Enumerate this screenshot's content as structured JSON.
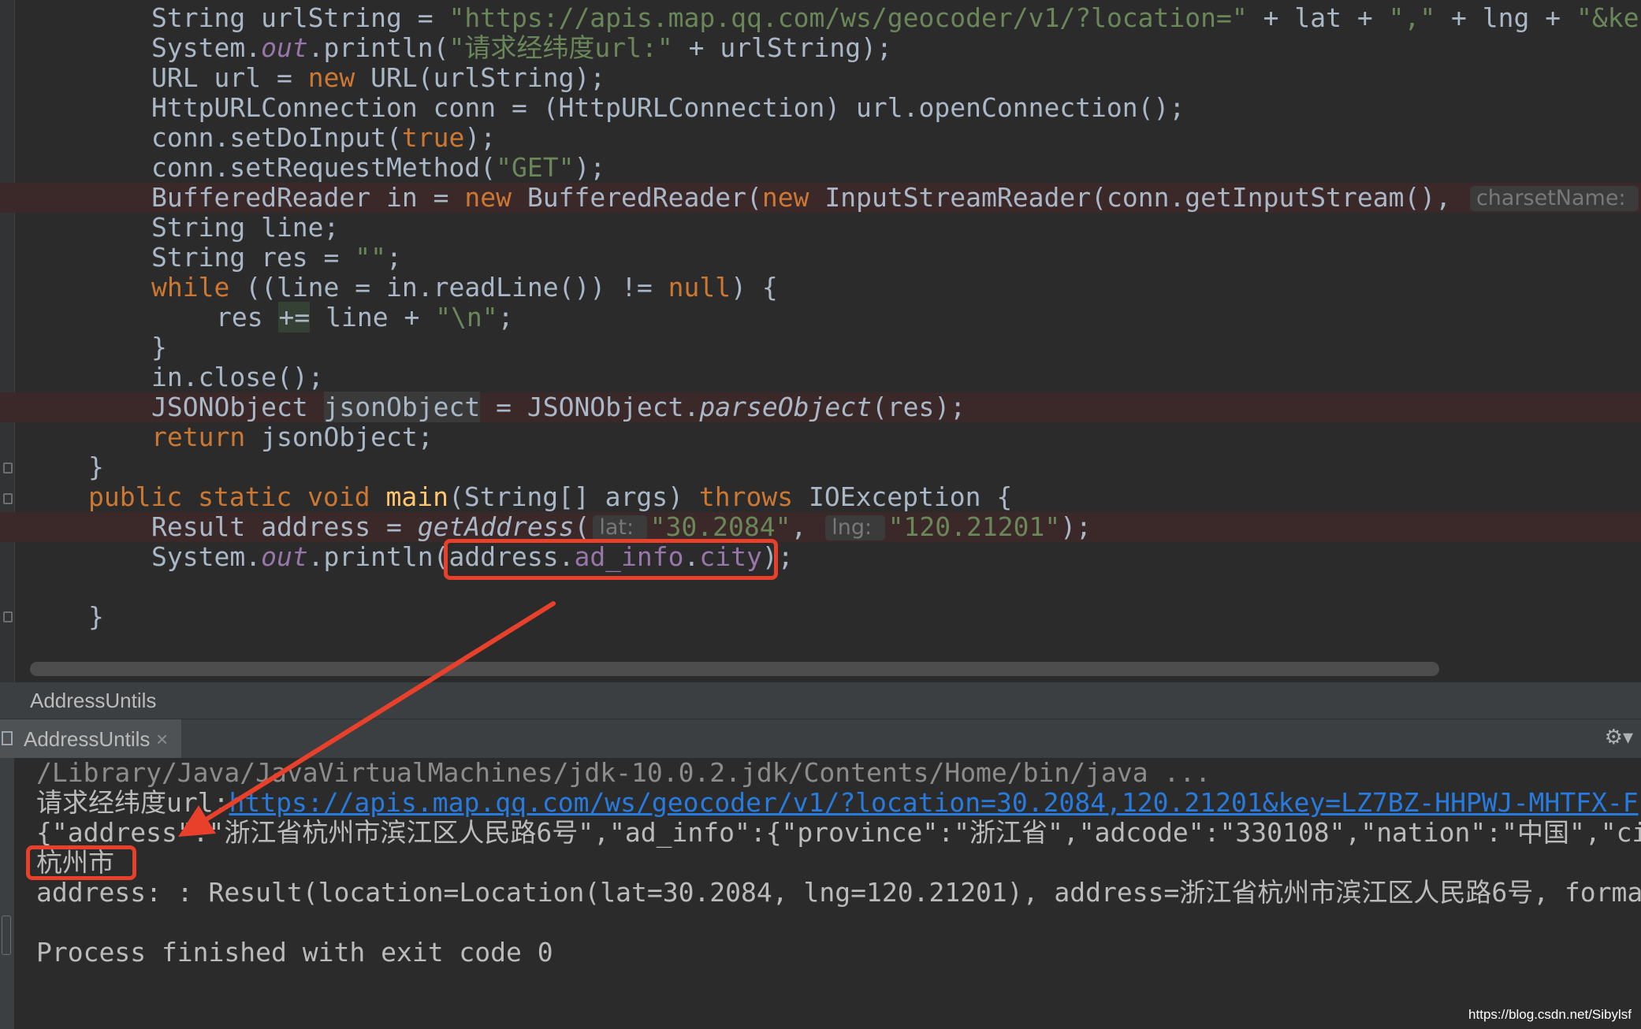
{
  "editor": {
    "lines": [
      {
        "segs": [
          {
            "t": "String urlString = ",
            "c": ""
          },
          {
            "t": "\"https://apis.map.qq.com/ws/geocoder/v1/?location=\"",
            "c": "str"
          },
          {
            "t": " + lat + ",
            "c": ""
          },
          {
            "t": "\",\"",
            "c": "str"
          },
          {
            "t": " + lng + ",
            "c": ""
          },
          {
            "t": "\"&ke",
            "c": "str"
          }
        ]
      },
      {
        "segs": [
          {
            "t": "System.",
            "c": ""
          },
          {
            "t": "out",
            "c": "fld"
          },
          {
            "t": ".println(",
            "c": ""
          },
          {
            "t": "\"请求经纬度url:\"",
            "c": "str"
          },
          {
            "t": " + urlString);",
            "c": ""
          }
        ]
      },
      {
        "segs": [
          {
            "t": "URL url = ",
            "c": ""
          },
          {
            "t": "new",
            "c": "kw"
          },
          {
            "t": " URL(urlString);",
            "c": ""
          }
        ]
      },
      {
        "segs": [
          {
            "t": "HttpURLConnection conn = (HttpURLConnection) url.openConnection();",
            "c": ""
          }
        ]
      },
      {
        "segs": [
          {
            "t": "conn.setDoInput(",
            "c": ""
          },
          {
            "t": "true",
            "c": "kw"
          },
          {
            "t": ");",
            "c": ""
          }
        ]
      },
      {
        "segs": [
          {
            "t": "conn.setRequestMethod(",
            "c": ""
          },
          {
            "t": "\"GET\"",
            "c": "str"
          },
          {
            "t": ");",
            "c": ""
          }
        ]
      },
      {
        "segs": [
          {
            "t": "BufferedReader ",
            "c": ""
          },
          {
            "t": "in",
            "c": ""
          },
          {
            "t": " = ",
            "c": ""
          },
          {
            "t": "new",
            "c": "kw"
          },
          {
            "t": " BufferedReader(",
            "c": ""
          },
          {
            "t": "new",
            "c": "kw"
          },
          {
            "t": " InputStreamReader(conn.getInputStream(), ",
            "c": ""
          },
          {
            "t": "charsetName: ",
            "c": "hint"
          }
        ]
      },
      {
        "segs": [
          {
            "t": "String line;",
            "c": ""
          }
        ]
      },
      {
        "segs": [
          {
            "t": "String res = ",
            "c": ""
          },
          {
            "t": "\"\"",
            "c": "str"
          },
          {
            "t": ";",
            "c": ""
          }
        ]
      },
      {
        "segs": [
          {
            "t": "while",
            "c": "kw"
          },
          {
            "t": " ((line = ",
            "c": ""
          },
          {
            "t": "in",
            "c": ""
          },
          {
            "t": ".readLine()) != ",
            "c": ""
          },
          {
            "t": "null",
            "c": "kw"
          },
          {
            "t": ") {",
            "c": ""
          }
        ]
      },
      {
        "segs": [
          {
            "t": "res ",
            "c": ""
          },
          {
            "t": "+=",
            "c": "hl"
          },
          {
            "t": " line + ",
            "c": ""
          },
          {
            "t": "\"\\n\"",
            "c": "str"
          },
          {
            "t": ";",
            "c": ""
          }
        ]
      },
      {
        "segs": [
          {
            "t": "}",
            "c": ""
          }
        ]
      },
      {
        "segs": [
          {
            "t": "in",
            "c": ""
          },
          {
            "t": ".close();",
            "c": ""
          }
        ]
      },
      {
        "segs": [
          {
            "t": "JSONObject ",
            "c": ""
          },
          {
            "t": "jsonObject",
            "c": "hl2"
          },
          {
            "t": " = JSONObject.",
            "c": ""
          },
          {
            "t": "parseObject",
            "c": "it"
          },
          {
            "t": "(res);",
            "c": ""
          }
        ]
      },
      {
        "segs": [
          {
            "t": "return",
            "c": "kw"
          },
          {
            "t": " jsonObject;",
            "c": ""
          }
        ]
      },
      {
        "segs": [
          {
            "t": "}",
            "c": ""
          }
        ]
      },
      {
        "segs": [
          {
            "t": "public static void",
            "c": "kw"
          },
          {
            "t": " ",
            "c": ""
          },
          {
            "t": "main",
            "c": "fn"
          },
          {
            "t": "(String[] args) ",
            "c": ""
          },
          {
            "t": "throws",
            "c": "kw"
          },
          {
            "t": " IOException {",
            "c": ""
          }
        ]
      },
      {
        "segs": [
          {
            "t": "Result address = ",
            "c": ""
          },
          {
            "t": "getAddress",
            "c": "it"
          },
          {
            "t": "(",
            "c": ""
          },
          {
            "t": "lat: ",
            "c": "hint"
          },
          {
            "t": "\"30.2084\"",
            "c": "str"
          },
          {
            "t": ", ",
            "c": ""
          },
          {
            "t": "lng: ",
            "c": "hint"
          },
          {
            "t": "\"120.21201\"",
            "c": "str"
          },
          {
            "t": ");",
            "c": ""
          }
        ]
      },
      {
        "segs": [
          {
            "t": "System.",
            "c": ""
          },
          {
            "t": "out",
            "c": "fld"
          },
          {
            "t": ".println(",
            "c": ""
          },
          {
            "t": "address.",
            "c": ""
          },
          {
            "t": "ad_info",
            "c": "fldn"
          },
          {
            "t": ".",
            "c": ""
          },
          {
            "t": "city",
            "c": "fldn"
          },
          {
            "t": ");",
            "c": ""
          }
        ]
      },
      {
        "segs": [
          {
            "t": "",
            "c": ""
          }
        ]
      },
      {
        "segs": [
          {
            "t": "}",
            "c": ""
          }
        ]
      }
    ]
  },
  "run_panel": {
    "title": "AddressUntils",
    "tab_label": "AddressUntils",
    "close_glyph": "×",
    "settings_glyph": "⚙▾"
  },
  "console": {
    "path_line": "/Library/Java/JavaVirtualMachines/jdk-10.0.2.jdk/Contents/Home/bin/java ...",
    "url_label": "请求经纬度url:",
    "url_link": "https://apis.map.qq.com/ws/geocoder/v1/?location=30.2084,120.21201&key=LZ7BZ-HHPWJ-MHTFX-F",
    "json_line": "{\"address\":\"浙江省杭州市滨江区人民路6号\",\"ad_info\":{\"province\":\"浙江省\",\"adcode\":\"330108\",\"nation\":\"中国\",\"ci",
    "city_line": "杭州市",
    "address_line": "address: : Result(location=Location(lat=30.2084, lng=120.21201), address=浙江省杭州市滨江区人民路6号, format",
    "exit_line": "Process finished with exit code 0"
  },
  "watermark": "https://blog.csdn.net/Sibylsf",
  "colors": {
    "annotation_red": "#e8402b",
    "editor_bg": "#2b2b2b",
    "keyword": "#cc7832",
    "string": "#6a8759",
    "field": "#9876aa",
    "link": "#287bde"
  }
}
